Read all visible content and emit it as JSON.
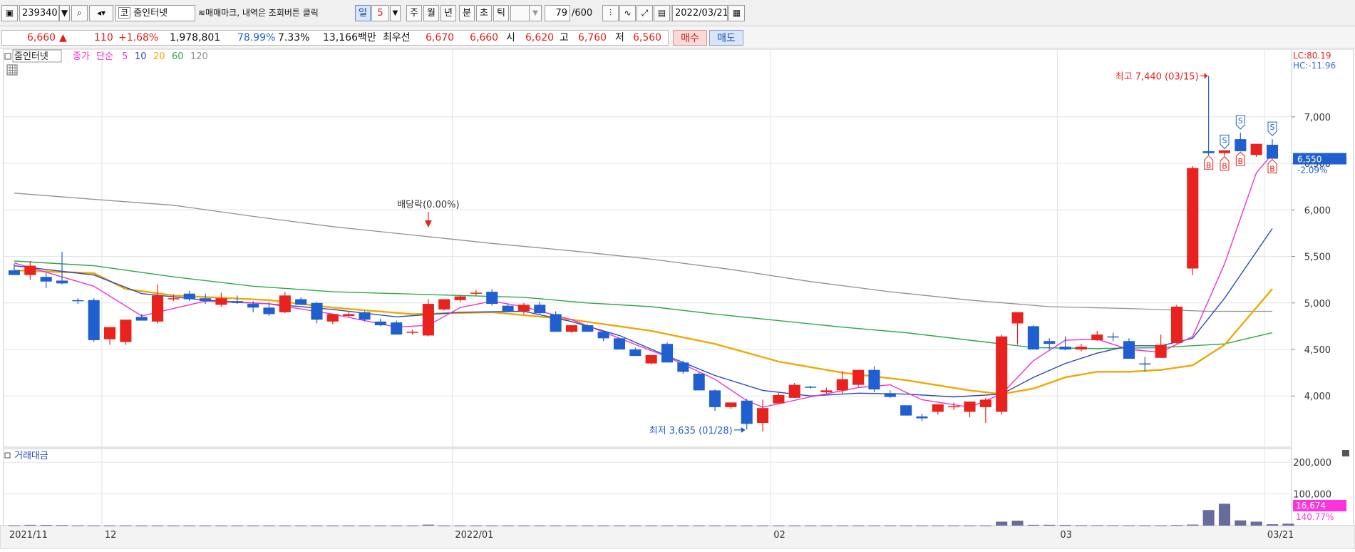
{
  "toolbar": {
    "code": "239340",
    "market_badge": "코",
    "name": "줌인터넷",
    "memo": "≋매매마크, 내역은 조회버튼 클릭",
    "periods": [
      "일",
      "5",
      "주",
      "월",
      "년",
      "분",
      "초",
      "틱"
    ],
    "active_period": "일",
    "count": "79",
    "count_total": "/600",
    "date": "2022/03/21"
  },
  "quote": {
    "price": "6,660",
    "arrow": "▲",
    "change": "110",
    "change_pct": "+1.68%",
    "volume": "1,978,801",
    "vol_ratio": "78.99%",
    "turnover": "7.33%",
    "amount": "13,166백만",
    "best_label": "최우선",
    "best_ask": "6,670",
    "best_bid": "6,660",
    "open_label": "시",
    "open": "6,620",
    "high_label": "고",
    "high": "6,760",
    "low_label": "저",
    "low": "6,560",
    "buy_label": "매수",
    "sell_label": "매도"
  },
  "chart_data": {
    "type": "candlestick",
    "legend": {
      "name": "줌인터넷",
      "close_label": "종가",
      "method_label": "단순",
      "periods": [
        "5",
        "10",
        "20",
        "60",
        "120"
      ]
    },
    "colors": {
      "up": "#e8221c",
      "down": "#1f5fd0",
      "ma5": "#ee33cc",
      "ma10": "#2c48b8",
      "ma20": "#f0a800",
      "ma60": "#2aa84a",
      "ma120": "#909090",
      "volume": "#676c9c"
    },
    "y_ticks": [
      4000,
      4500,
      5000,
      5500,
      6000,
      6500,
      7000
    ],
    "y_tick_labels": [
      "4,000",
      "4,500",
      "5,000",
      "5,500",
      "6,000",
      "6,500",
      "7,000"
    ],
    "ylim": [
      3450,
      7650
    ],
    "x_labels": [
      {
        "i": 0,
        "label": "2021/11"
      },
      {
        "i": 6,
        "label": "12"
      },
      {
        "i": 28,
        "label": "2022/01"
      },
      {
        "i": 48,
        "label": "02"
      },
      {
        "i": 66,
        "label": "03"
      },
      {
        "i": 79,
        "label": "03/21"
      }
    ],
    "candles": [
      [
        5350,
        5420,
        5300,
        5300
      ],
      [
        5300,
        5450,
        5250,
        5400
      ],
      [
        5280,
        5320,
        5160,
        5230
      ],
      [
        5240,
        5550,
        5200,
        5210
      ],
      [
        5030,
        5050,
        4990,
        5020
      ],
      [
        5030,
        5050,
        4580,
        4600
      ],
      [
        4610,
        4720,
        4550,
        4740
      ],
      [
        4580,
        4820,
        4550,
        4820
      ],
      [
        4850,
        4880,
        4810,
        4810
      ],
      [
        4800,
        5200,
        4780,
        5080
      ],
      [
        5050,
        5090,
        5020,
        5050
      ],
      [
        5100,
        5130,
        5020,
        5040
      ],
      [
        5050,
        5100,
        4990,
        5020
      ],
      [
        4980,
        5110,
        4960,
        5050
      ],
      [
        5020,
        5080,
        4990,
        5000
      ],
      [
        4990,
        5020,
        4900,
        4950
      ],
      [
        4950,
        5010,
        4860,
        4880
      ],
      [
        4900,
        5120,
        4890,
        5080
      ],
      [
        5040,
        5060,
        4980,
        4980
      ],
      [
        5000,
        5010,
        4780,
        4820
      ],
      [
        4800,
        4880,
        4770,
        4880
      ],
      [
        4860,
        4900,
        4850,
        4880
      ],
      [
        4900,
        4910,
        4800,
        4820
      ],
      [
        4800,
        4830,
        4750,
        4760
      ],
      [
        4790,
        4810,
        4660,
        4660
      ],
      [
        4680,
        4710,
        4660,
        4690
      ],
      [
        4650,
        5040,
        4640,
        4990
      ],
      [
        4930,
        5020,
        4920,
        5040
      ],
      [
        5030,
        5080,
        5010,
        5070
      ],
      [
        5100,
        5140,
        5080,
        5110
      ],
      [
        5120,
        5150,
        4970,
        4990
      ],
      [
        4970,
        4990,
        4900,
        4910
      ],
      [
        4910,
        5000,
        4880,
        4980
      ],
      [
        4980,
        5010,
        4880,
        4890
      ],
      [
        4880,
        4910,
        4740,
        4690
      ],
      [
        4690,
        4760,
        4680,
        4760
      ],
      [
        4760,
        4770,
        4690,
        4690
      ],
      [
        4690,
        4700,
        4590,
        4620
      ],
      [
        4620,
        4620,
        4500,
        4500
      ],
      [
        4500,
        4520,
        4440,
        4430
      ],
      [
        4350,
        4440,
        4340,
        4440
      ],
      [
        4560,
        4580,
        4360,
        4360
      ],
      [
        4360,
        4380,
        4240,
        4260
      ],
      [
        4240,
        4260,
        4060,
        4060
      ],
      [
        4060,
        4070,
        3840,
        3880
      ],
      [
        3880,
        3910,
        3860,
        3930
      ],
      [
        3950,
        3970,
        3640,
        3700
      ],
      [
        3710,
        3960,
        3620,
        3870
      ],
      [
        3920,
        4030,
        3920,
        4010
      ],
      [
        3980,
        4140,
        3980,
        4120
      ],
      [
        4100,
        4110,
        4080,
        4090
      ],
      [
        4040,
        4090,
        4030,
        4060
      ],
      [
        4060,
        4270,
        4020,
        4180
      ],
      [
        4120,
        4280,
        4100,
        4280
      ],
      [
        4280,
        4320,
        4040,
        4070
      ],
      [
        4030,
        4060,
        3980,
        3990
      ],
      [
        3900,
        3900,
        3790,
        3790
      ],
      [
        3780,
        3810,
        3730,
        3760
      ],
      [
        3830,
        3870,
        3800,
        3910
      ],
      [
        3880,
        3930,
        3850,
        3890
      ],
      [
        3830,
        3930,
        3770,
        3940
      ],
      [
        3880,
        3980,
        3710,
        3960
      ],
      [
        3830,
        4660,
        3800,
        4640
      ],
      [
        4780,
        4900,
        4550,
        4900
      ],
      [
        4750,
        4760,
        4520,
        4500
      ],
      [
        4590,
        4620,
        4500,
        4560
      ],
      [
        4530,
        4640,
        4490,
        4500
      ],
      [
        4500,
        4560,
        4480,
        4530
      ],
      [
        4600,
        4700,
        4590,
        4660
      ],
      [
        4640,
        4680,
        4590,
        4630
      ],
      [
        4590,
        4620,
        4420,
        4400
      ],
      [
        4350,
        4420,
        4260,
        4340
      ],
      [
        4410,
        4660,
        4410,
        4550
      ],
      [
        4570,
        4980,
        4560,
        4960
      ],
      [
        5370,
        6470,
        5300,
        6450
      ],
      [
        6630,
        7440,
        6590,
        6610
      ],
      [
        6610,
        6620,
        6580,
        6640
      ],
      [
        6760,
        6830,
        6640,
        6630
      ],
      [
        6590,
        6700,
        6570,
        6710
      ],
      [
        6700,
        6760,
        6560,
        6550
      ]
    ],
    "ma": {
      "ma5": [
        [
          0,
          5430
        ],
        [
          5,
          5180
        ],
        [
          8,
          4860
        ],
        [
          12,
          5020
        ],
        [
          16,
          4990
        ],
        [
          20,
          4880
        ],
        [
          24,
          4740
        ],
        [
          26,
          4760
        ],
        [
          28,
          4950
        ],
        [
          30,
          5020
        ],
        [
          32,
          4960
        ],
        [
          35,
          4820
        ],
        [
          38,
          4620
        ],
        [
          41,
          4420
        ],
        [
          44,
          4180
        ],
        [
          46,
          3950
        ],
        [
          47,
          3880
        ],
        [
          50,
          3990
        ],
        [
          53,
          4090
        ],
        [
          55,
          4120
        ],
        [
          57,
          3960
        ],
        [
          60,
          3880
        ],
        [
          62,
          4020
        ],
        [
          64,
          4380
        ],
        [
          66,
          4600
        ],
        [
          68,
          4610
        ],
        [
          70,
          4500
        ],
        [
          72,
          4470
        ],
        [
          74,
          4640
        ],
        [
          76,
          5420
        ],
        [
          78,
          6400
        ],
        [
          79,
          6600
        ]
      ],
      "ma10": [
        [
          0,
          5400
        ],
        [
          5,
          5300
        ],
        [
          8,
          5100
        ],
        [
          12,
          5030
        ],
        [
          16,
          4990
        ],
        [
          20,
          4930
        ],
        [
          24,
          4850
        ],
        [
          28,
          4900
        ],
        [
          32,
          4910
        ],
        [
          35,
          4800
        ],
        [
          38,
          4650
        ],
        [
          41,
          4430
        ],
        [
          44,
          4220
        ],
        [
          47,
          4060
        ],
        [
          50,
          4000
        ],
        [
          53,
          4030
        ],
        [
          56,
          4020
        ],
        [
          59,
          3990
        ],
        [
          62,
          4020
        ],
        [
          64,
          4200
        ],
        [
          66,
          4350
        ],
        [
          68,
          4460
        ],
        [
          70,
          4540
        ],
        [
          72,
          4540
        ],
        [
          74,
          4620
        ],
        [
          76,
          5050
        ],
        [
          79,
          5800
        ]
      ],
      "ma20": [
        [
          0,
          5350
        ],
        [
          5,
          5320
        ],
        [
          7,
          5150
        ],
        [
          10,
          5080
        ],
        [
          16,
          5030
        ],
        [
          20,
          4950
        ],
        [
          25,
          4880
        ],
        [
          30,
          4900
        ],
        [
          35,
          4820
        ],
        [
          40,
          4700
        ],
        [
          44,
          4560
        ],
        [
          48,
          4370
        ],
        [
          52,
          4250
        ],
        [
          56,
          4170
        ],
        [
          60,
          4060
        ],
        [
          62,
          4020
        ],
        [
          64,
          4080
        ],
        [
          66,
          4200
        ],
        [
          68,
          4260
        ],
        [
          70,
          4260
        ],
        [
          72,
          4280
        ],
        [
          74,
          4330
        ],
        [
          76,
          4550
        ],
        [
          79,
          5150
        ]
      ],
      "ma60": [
        [
          0,
          5450
        ],
        [
          5,
          5400
        ],
        [
          10,
          5280
        ],
        [
          15,
          5180
        ],
        [
          20,
          5120
        ],
        [
          28,
          5080
        ],
        [
          32,
          5060
        ],
        [
          36,
          5000
        ],
        [
          40,
          4960
        ],
        [
          44,
          4880
        ],
        [
          48,
          4810
        ],
        [
          52,
          4740
        ],
        [
          56,
          4680
        ],
        [
          60,
          4600
        ],
        [
          62,
          4560
        ],
        [
          64,
          4520
        ],
        [
          68,
          4510
        ],
        [
          72,
          4520
        ],
        [
          76,
          4560
        ],
        [
          79,
          4680
        ]
      ],
      "ma120": [
        [
          0,
          6180
        ],
        [
          6,
          6100
        ],
        [
          10,
          6050
        ],
        [
          15,
          5930
        ],
        [
          20,
          5820
        ],
        [
          25,
          5730
        ],
        [
          30,
          5640
        ],
        [
          35,
          5560
        ],
        [
          40,
          5470
        ],
        [
          45,
          5360
        ],
        [
          50,
          5230
        ],
        [
          55,
          5120
        ],
        [
          60,
          5030
        ],
        [
          65,
          4960
        ],
        [
          70,
          4940
        ],
        [
          75,
          4910
        ],
        [
          79,
          4910
        ]
      ]
    },
    "volume_panel": {
      "title": "거래대금",
      "y_ticks": [
        100000,
        200000
      ],
      "y_tick_labels": [
        "100,000",
        "200,000"
      ],
      "ylim": [
        0,
        225000
      ],
      "values": [
        1200,
        2500,
        2200,
        1800,
        600,
        700,
        500,
        400,
        300,
        300,
        300,
        300,
        300,
        300,
        300,
        300,
        300,
        300,
        300,
        300,
        300,
        300,
        300,
        300,
        300,
        300,
        3200,
        400,
        400,
        400,
        400,
        400,
        400,
        400,
        400,
        400,
        400,
        400,
        400,
        400,
        400,
        400,
        400,
        400,
        400,
        400,
        400,
        400,
        400,
        400,
        400,
        400,
        400,
        400,
        400,
        400,
        400,
        400,
        400,
        400,
        400,
        400,
        12500,
        15500,
        2600,
        2700,
        2300,
        1400,
        1300,
        1300,
        1000,
        900,
        900,
        1700,
        3300,
        49000,
        69000,
        16500,
        12500,
        4300,
        6000
      ],
      "current_label": "16,674",
      "current_pct": "140.77%"
    },
    "annotations": {
      "dividend": "배당락(0.00%)",
      "high_note": "최고 7,440 (03/15)",
      "low_note": "최저 3,635 (01/28)",
      "lc": "LC:80.19",
      "hc": "HC:-11.96",
      "last_price": "6,550",
      "last_pct": "-2.09%",
      "buy_mark": "B",
      "sell_mark": "S",
      "buy_marks_at": [
        75,
        76,
        77,
        79
      ],
      "sell_marks_at": [
        76,
        77,
        79
      ]
    }
  }
}
